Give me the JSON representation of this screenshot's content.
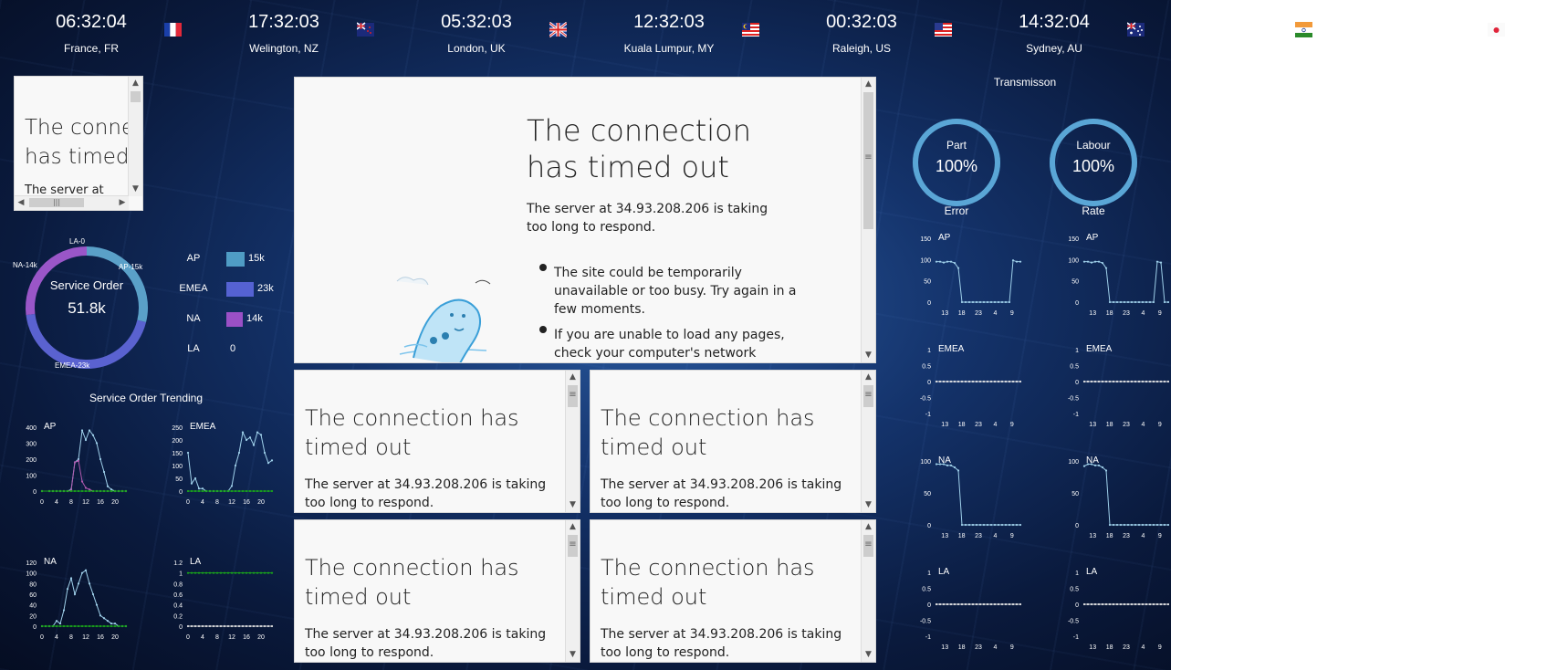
{
  "clocks": [
    {
      "time": "06:32:04",
      "location": "France, FR",
      "flag": "fr-flag"
    },
    {
      "time": "17:32:03",
      "location": "Welington, NZ",
      "flag": "nz-flag"
    },
    {
      "time": "05:32:03",
      "location": "London, UK",
      "flag": "uk-flag"
    },
    {
      "time": "12:32:03",
      "location": "Kuala Lumpur, MY",
      "flag": "my-flag"
    },
    {
      "time": "00:32:03",
      "location": "Raleigh, US",
      "flag": "us-flag"
    },
    {
      "time": "14:32:04",
      "location": "Sydney, AU",
      "flag": "au-flag"
    }
  ],
  "error_page": {
    "heading": "The connection has timed out",
    "heading_small": "The conne has timed",
    "heading_small_line1": "The conne",
    "heading_small_line2": "has timed",
    "body": "The server at 34.93.208.206 is taking too long to respond.",
    "body_small": "The server at",
    "bullet1": "The site could be temporarily unavailable or too busy. Try again in a few moments.",
    "bullet2": "If you are unable to load any pages, check your computer's network"
  },
  "service_order": {
    "title": "Service Order",
    "total": "51.8k",
    "segments": [
      {
        "name": "LA-0",
        "value": 0,
        "color": "#9ad0e8"
      },
      {
        "name": "AP-15k",
        "value": 15,
        "color": "#5aa0c8"
      },
      {
        "name": "EMEA-23k",
        "value": 23,
        "color": "#5a62d0"
      },
      {
        "name": "NA-14k",
        "value": 14,
        "color": "#9a56c8"
      }
    ],
    "legend": [
      {
        "label": "AP",
        "value": "15k",
        "color": "#4f9cc5",
        "amount": 15
      },
      {
        "label": "EMEA",
        "value": "23k",
        "color": "#5562d2",
        "amount": 23
      },
      {
        "label": "NA",
        "value": "14k",
        "color": "#9a50c6",
        "amount": 14
      },
      {
        "label": "LA",
        "value": "0",
        "color": "#9a50c6",
        "amount": 0
      }
    ]
  },
  "trending": {
    "title": "Service Order Trending"
  },
  "transmission": {
    "title": "Transmisson",
    "gauges": [
      {
        "label": "Part",
        "value": "100%",
        "caption": "Error",
        "fraction": 1.0
      },
      {
        "label": "Labour",
        "value": "100%",
        "caption": "Rate",
        "fraction": 1.0
      }
    ]
  },
  "chart_data": [
    {
      "type": "line",
      "title": "AP",
      "x": [
        0,
        2,
        3,
        4,
        5,
        6,
        7,
        8,
        9,
        10,
        11,
        12,
        13,
        14,
        15,
        16,
        17,
        18,
        19,
        20,
        21,
        22,
        23
      ],
      "series": [
        {
          "values": [
            0,
            0,
            0,
            0,
            0,
            0,
            0,
            10,
            180,
            200,
            380,
            320,
            380,
            350,
            300,
            200,
            120,
            30,
            10,
            0,
            0,
            0,
            0
          ],
          "color": "#9fd0ea"
        },
        {
          "values": [
            0,
            0,
            0,
            0,
            0,
            0,
            0,
            5,
            180,
            190,
            60,
            20,
            10,
            0,
            0,
            0,
            0,
            0,
            0,
            0,
            0,
            0,
            0
          ],
          "color": "#b05ab0"
        },
        {
          "values": [
            0,
            0,
            0,
            0,
            0,
            0,
            0,
            0,
            0,
            0,
            0,
            0,
            0,
            0,
            0,
            0,
            0,
            0,
            0,
            0,
            0,
            0,
            0
          ],
          "color": "#1aa81a"
        }
      ],
      "yticks": [
        0,
        100,
        200,
        300,
        400
      ],
      "xticks": [
        0,
        4,
        8,
        12,
        16,
        20
      ],
      "ylim": [
        0,
        400
      ]
    },
    {
      "type": "line",
      "title": "EMEA",
      "x": [
        0,
        1,
        2,
        3,
        4,
        5,
        6,
        7,
        8,
        9,
        10,
        11,
        12,
        13,
        14,
        15,
        16,
        17,
        18,
        19,
        20,
        21,
        22,
        23
      ],
      "series": [
        {
          "values": [
            150,
            30,
            50,
            10,
            10,
            0,
            0,
            0,
            0,
            0,
            0,
            0,
            20,
            100,
            150,
            230,
            200,
            210,
            180,
            230,
            220,
            150,
            110,
            120
          ],
          "color": "#9fd0ea"
        },
        {
          "values": [
            0,
            0,
            0,
            0,
            0,
            0,
            0,
            0,
            0,
            0,
            0,
            0,
            0,
            0,
            0,
            0,
            0,
            0,
            0,
            0,
            0,
            0,
            0,
            0
          ],
          "color": "#1aa81a"
        }
      ],
      "yticks": [
        0,
        50,
        100,
        150,
        200,
        250
      ],
      "xticks": [
        0,
        4,
        8,
        12,
        16,
        20
      ],
      "ylim": [
        0,
        250
      ]
    },
    {
      "type": "line",
      "title": "NA",
      "x": [
        0,
        1,
        2,
        3,
        4,
        5,
        6,
        7,
        8,
        9,
        10,
        11,
        12,
        13,
        14,
        15,
        16,
        17,
        18,
        19,
        20,
        21,
        22,
        23
      ],
      "series": [
        {
          "values": [
            0,
            0,
            0,
            0,
            10,
            5,
            30,
            70,
            90,
            60,
            80,
            100,
            105,
            80,
            60,
            40,
            20,
            15,
            10,
            5,
            5,
            0,
            0,
            0
          ],
          "color": "#9fd0ea"
        },
        {
          "values": [
            0,
            0,
            0,
            0,
            0,
            0,
            0,
            0,
            0,
            0,
            0,
            0,
            0,
            0,
            0,
            0,
            0,
            0,
            0,
            0,
            0,
            0,
            0,
            0
          ],
          "color": "#1aa81a"
        }
      ],
      "yticks": [
        0,
        20,
        40,
        60,
        80,
        100,
        120
      ],
      "xticks": [
        0,
        4,
        8,
        12,
        16,
        20
      ],
      "ylim": [
        0,
        120
      ]
    },
    {
      "type": "line",
      "title": "LA",
      "x": [
        0,
        1,
        2,
        3,
        4,
        5,
        6,
        7,
        8,
        9,
        10,
        11,
        12,
        13,
        14,
        15,
        16,
        17,
        18,
        19,
        20,
        21,
        22,
        23
      ],
      "series": [
        {
          "values": [
            1,
            1,
            1,
            1,
            1,
            1,
            1,
            1,
            1,
            1,
            1,
            1,
            1,
            1,
            1,
            1,
            1,
            1,
            1,
            1,
            1,
            1,
            1,
            1
          ],
          "color": "#1aa81a"
        },
        {
          "values": [
            0,
            0,
            0,
            0,
            0,
            0,
            0,
            0,
            0,
            0,
            0,
            0,
            0,
            0,
            0,
            0,
            0,
            0,
            0,
            0,
            0,
            0,
            0,
            0
          ],
          "color": "#e0e0e0"
        }
      ],
      "yticks": [
        0,
        0.2,
        0.4,
        0.6,
        0.8,
        1,
        1.2
      ],
      "xticks": [
        0,
        4,
        8,
        12,
        16,
        20
      ],
      "ylim": [
        0,
        1.2
      ]
    },
    {
      "type": "line",
      "title": "AP",
      "x": [
        0,
        1,
        2,
        3,
        4,
        5,
        6,
        7,
        8,
        9,
        10,
        11,
        12,
        13,
        14,
        15,
        16,
        17,
        18,
        19,
        20,
        21,
        22,
        23
      ],
      "series": [
        {
          "values": [
            95,
            95,
            93,
            95,
            95,
            92,
            80,
            0,
            0,
            0,
            0,
            0,
            0,
            0,
            0,
            0,
            0,
            0,
            0,
            0,
            0,
            98,
            95,
            95
          ],
          "color": "#9fd0ea"
        }
      ],
      "yticks": [
        0,
        50,
        100,
        150
      ],
      "xticks": [
        "13",
        "18",
        "23",
        "4",
        "9"
      ],
      "ylim": [
        0,
        150
      ]
    },
    {
      "type": "line",
      "title": "AP",
      "x": [
        0,
        1,
        2,
        3,
        4,
        5,
        6,
        7,
        8,
        9,
        10,
        11,
        12,
        13,
        14,
        15,
        16,
        17,
        18,
        19,
        20,
        21,
        22,
        23
      ],
      "series": [
        {
          "values": [
            95,
            95,
            93,
            95,
            95,
            92,
            80,
            0,
            0,
            0,
            0,
            0,
            0,
            0,
            0,
            0,
            0,
            0,
            0,
            0,
            95,
            93,
            0,
            0
          ],
          "color": "#9fd0ea"
        }
      ],
      "yticks": [
        0,
        50,
        100,
        150
      ],
      "xticks": [
        "13",
        "18",
        "23",
        "4",
        "9"
      ],
      "ylim": [
        0,
        150
      ]
    },
    {
      "type": "line",
      "title": "EMEA",
      "x": [
        0,
        1,
        2,
        3,
        4,
        5,
        6,
        7,
        8,
        9,
        10,
        11,
        12,
        13,
        14,
        15,
        16,
        17,
        18,
        19,
        20,
        21,
        22,
        23
      ],
      "series": [
        {
          "values": [
            0,
            0,
            0,
            0,
            0,
            0,
            0,
            0,
            0,
            0,
            0,
            0,
            0,
            0,
            0,
            0,
            0,
            0,
            0,
            0,
            0,
            0,
            0,
            0
          ],
          "color": "#e8e8e8"
        }
      ],
      "yticks": [
        -1,
        -0.5,
        0,
        0.5,
        1
      ],
      "xticks": [
        "13",
        "18",
        "23",
        "4",
        "9"
      ],
      "ylim": [
        -1,
        1
      ]
    },
    {
      "type": "line",
      "title": "EMEA",
      "x": [
        0,
        1,
        2,
        3,
        4,
        5,
        6,
        7,
        8,
        9,
        10,
        11,
        12,
        13,
        14,
        15,
        16,
        17,
        18,
        19,
        20,
        21,
        22,
        23
      ],
      "series": [
        {
          "values": [
            0,
            0,
            0,
            0,
            0,
            0,
            0,
            0,
            0,
            0,
            0,
            0,
            0,
            0,
            0,
            0,
            0,
            0,
            0,
            0,
            0,
            0,
            0,
            0
          ],
          "color": "#e8e8e8"
        }
      ],
      "yticks": [
        -1,
        -0.5,
        0,
        0.5,
        1
      ],
      "xticks": [
        "13",
        "18",
        "23",
        "4",
        "9"
      ],
      "ylim": [
        -1,
        1
      ]
    },
    {
      "type": "line",
      "title": "NA",
      "x": [
        0,
        1,
        2,
        3,
        4,
        5,
        6,
        7,
        8,
        9,
        10,
        11,
        12,
        13,
        14,
        15,
        16,
        17,
        18,
        19,
        20,
        21,
        22,
        23
      ],
      "series": [
        {
          "values": [
            95,
            95,
            95,
            93,
            93,
            90,
            85,
            0,
            0,
            0,
            0,
            0,
            0,
            0,
            0,
            0,
            0,
            0,
            0,
            0,
            0,
            0,
            0,
            0
          ],
          "color": "#9fd0ea"
        }
      ],
      "yticks": [
        0,
        50,
        100
      ],
      "xticks": [
        "13",
        "18",
        "23",
        "4",
        "9"
      ],
      "ylim": [
        0,
        100
      ]
    },
    {
      "type": "line",
      "title": "NA",
      "x": [
        0,
        1,
        2,
        3,
        4,
        5,
        6,
        7,
        8,
        9,
        10,
        11,
        12,
        13,
        14,
        15,
        16,
        17,
        18,
        19,
        20,
        21,
        22,
        23
      ],
      "series": [
        {
          "values": [
            92,
            95,
            95,
            93,
            93,
            90,
            85,
            0,
            0,
            0,
            0,
            0,
            0,
            0,
            0,
            0,
            0,
            0,
            0,
            0,
            0,
            0,
            0,
            0
          ],
          "color": "#9fd0ea"
        }
      ],
      "yticks": [
        0,
        50,
        100
      ],
      "xticks": [
        "13",
        "18",
        "23",
        "4",
        "9"
      ],
      "ylim": [
        0,
        100
      ]
    },
    {
      "type": "line",
      "title": "LA",
      "x": [
        0,
        1,
        2,
        3,
        4,
        5,
        6,
        7,
        8,
        9,
        10,
        11,
        12,
        13,
        14,
        15,
        16,
        17,
        18,
        19,
        20,
        21,
        22,
        23
      ],
      "series": [
        {
          "values": [
            0,
            0,
            0,
            0,
            0,
            0,
            0,
            0,
            0,
            0,
            0,
            0,
            0,
            0,
            0,
            0,
            0,
            0,
            0,
            0,
            0,
            0,
            0,
            0
          ],
          "color": "#e8e8e8"
        }
      ],
      "yticks": [
        -1,
        -0.5,
        0,
        0.5,
        1
      ],
      "xticks": [
        "13",
        "18",
        "23",
        "4",
        "9"
      ],
      "ylim": [
        -1,
        1
      ]
    },
    {
      "type": "line",
      "title": "LA",
      "x": [
        0,
        1,
        2,
        3,
        4,
        5,
        6,
        7,
        8,
        9,
        10,
        11,
        12,
        13,
        14,
        15,
        16,
        17,
        18,
        19,
        20,
        21,
        22,
        23
      ],
      "series": [
        {
          "values": [
            0,
            0,
            0,
            0,
            0,
            0,
            0,
            0,
            0,
            0,
            0,
            0,
            0,
            0,
            0,
            0,
            0,
            0,
            0,
            0,
            0,
            0,
            0,
            0
          ],
          "color": "#e8e8e8"
        }
      ],
      "yticks": [
        -1,
        -0.5,
        0,
        0.5,
        1
      ],
      "xticks": [
        "13",
        "18",
        "23",
        "4",
        "9"
      ],
      "ylim": [
        -1,
        1
      ]
    }
  ]
}
